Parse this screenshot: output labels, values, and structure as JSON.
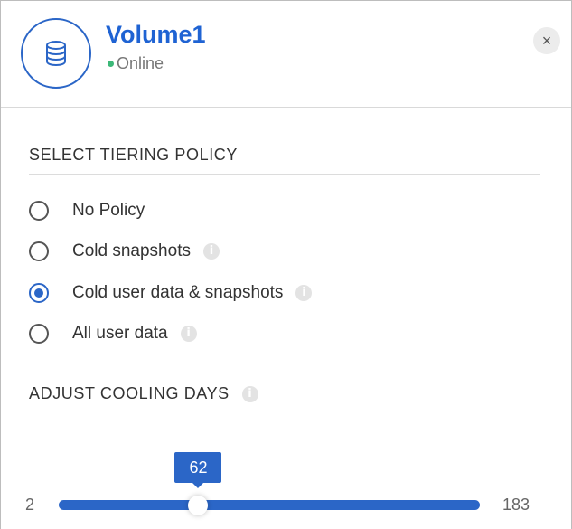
{
  "volume": {
    "name": "Volume1",
    "status": "Online",
    "status_color": "#3cb878",
    "icon": "database-icon"
  },
  "header": {
    "close_label": "×",
    "close_icon": "close-icon"
  },
  "tiering_policy": {
    "title": "SELECT TIERING POLICY",
    "options": [
      {
        "label": "No Policy",
        "checked": false,
        "info": false
      },
      {
        "label": "Cold snapshots",
        "checked": false,
        "info": true
      },
      {
        "label": "Cold user data & snapshots",
        "checked": true,
        "info": true
      },
      {
        "label": "All user data",
        "checked": false,
        "info": true
      }
    ]
  },
  "cooling_days": {
    "title": "ADJUST COOLING DAYS",
    "min": "2",
    "max": "183",
    "value": "62"
  },
  "colors": {
    "accent": "#2b66c7",
    "title_blue": "#1f63d3"
  }
}
